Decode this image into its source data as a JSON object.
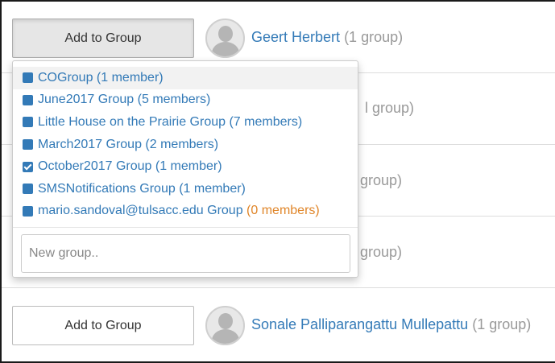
{
  "rows": [
    {
      "button_label": "Add to Group",
      "name": "Geert Herbert",
      "count": "(1 group)"
    },
    {
      "partial_count": "l group)"
    },
    {
      "partial_count": "group)"
    },
    {
      "partial_count": "group)"
    },
    {
      "button_label": "Add to Group",
      "name": "Sonale Palliparangattu Mullepattu",
      "count": "(1 group)"
    }
  ],
  "dropdown": {
    "items": [
      {
        "name": "COGroup",
        "count": "(1 member)",
        "checked": false
      },
      {
        "name": "June2017 Group",
        "count": "(5 members)",
        "checked": false
      },
      {
        "name": "Little House on the Prairie Group",
        "count": "(7 members)",
        "checked": false
      },
      {
        "name": "March2017 Group",
        "count": "(2 members)",
        "checked": false
      },
      {
        "name": "October2017 Group",
        "count": "(1 member)",
        "checked": true
      },
      {
        "name": "SMSNotifications Group",
        "count": "(1 member)",
        "checked": false
      },
      {
        "name": "mario.sandoval@tulsacc.edu Group",
        "count": "(0 members)",
        "checked": false
      }
    ],
    "new_group_placeholder": "New group.."
  },
  "colors": {
    "link": "#337ab7",
    "muted": "#999999",
    "zero_count": "#e0862a"
  }
}
